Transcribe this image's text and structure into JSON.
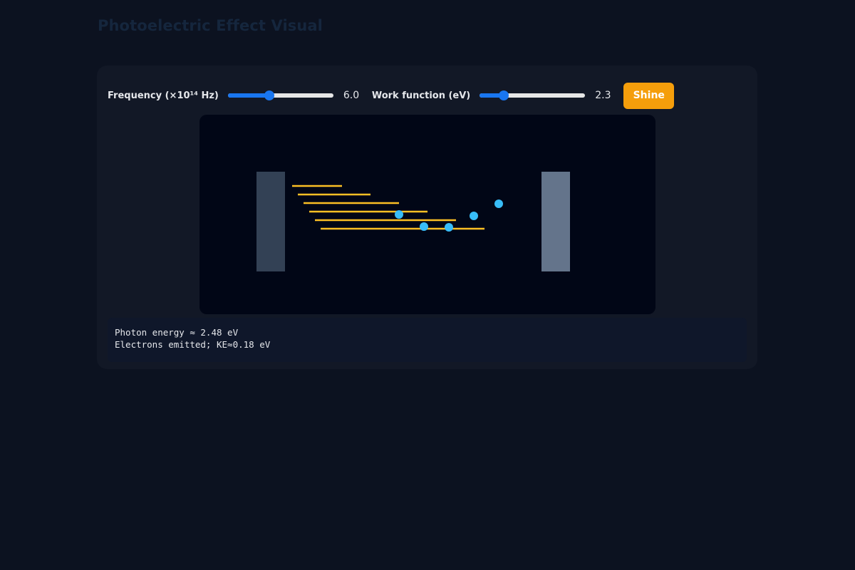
{
  "header": {
    "title": "Photoelectric Effect Visual",
    "subtitle": ""
  },
  "controls": {
    "frequency": {
      "label": "Frequency (×10¹⁴ Hz)",
      "value": "6.0",
      "fraction": 0.38
    },
    "work_function": {
      "label": "Work function (eV)",
      "value": "2.3",
      "fraction": 0.2
    },
    "shine_label": "Shine"
  },
  "stage": {
    "emitter_plate_color": "#334155",
    "collector_plate_color": "#64748b",
    "photon_color": "#fbbf24",
    "electron_color": "#38bdf8",
    "photon_count": 6,
    "electron_count": 5
  },
  "readout": {
    "photon_energy": "Photon energy ≈ 2.48 eV",
    "status": "Electrons emitted; KE≈0.18 eV"
  },
  "colors": {
    "background": "#0c1220",
    "panel": "#121826",
    "accent": "#1976f0",
    "button": "#f59e0b"
  }
}
